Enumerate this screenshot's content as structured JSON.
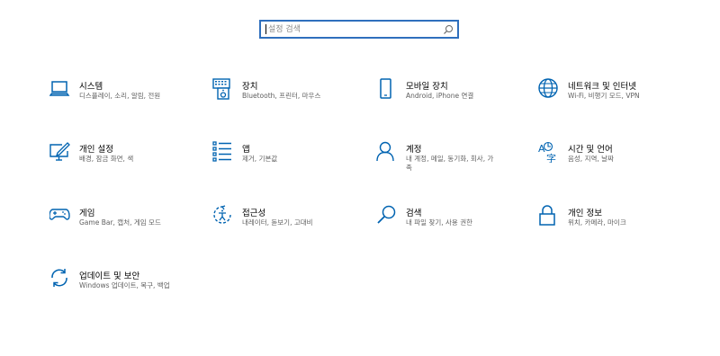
{
  "search": {
    "placeholder": "설정 검색",
    "icon": "search-icon"
  },
  "accent_color": "#0063b1",
  "tiles": [
    {
      "title": "시스템",
      "desc": "디스플레이, 소리, 알림, 전원",
      "icon": "laptop-icon"
    },
    {
      "title": "장치",
      "desc": "Bluetooth, 프린터, 마우스",
      "icon": "keyboard-speaker-icon"
    },
    {
      "title": "모바일 장치",
      "desc": "Android, iPhone 연결",
      "icon": "phone-icon"
    },
    {
      "title": "네트워크 및 인터넷",
      "desc": "Wi-Fi, 비행기 모드, VPN",
      "icon": "globe-icon"
    },
    {
      "title": "개인 설정",
      "desc": "배경, 잠금 화면, 색",
      "icon": "pen-monitor-icon"
    },
    {
      "title": "앱",
      "desc": "제거, 기본값",
      "icon": "apps-list-icon"
    },
    {
      "title": "계정",
      "desc": "내 계정, 메일, 동기화, 회사, 가\n족",
      "desc_line1": "내 계정, 메일, 동기화, 회사, 가",
      "desc_line2": "족",
      "icon": "person-icon"
    },
    {
      "title": "시간 및 언어",
      "desc": "음성, 지역, 날짜",
      "icon": "language-time-icon"
    },
    {
      "title": "게임",
      "desc": "Game Bar, 캡처, 게임 모드",
      "icon": "gamepad-icon"
    },
    {
      "title": "접근성",
      "desc": "내레이터, 돋보기, 고대비",
      "icon": "ease-of-access-icon"
    },
    {
      "title": "검색",
      "desc": "내 파일 찾기, 사용 권한",
      "icon": "search-magnifier-icon"
    },
    {
      "title": "개인 정보",
      "desc": "위치, 카메라, 마이크",
      "icon": "lock-icon"
    },
    {
      "title": "업데이트 및 보안",
      "desc": "Windows 업데이트, 복구, 백업",
      "icon": "refresh-arrows-icon"
    }
  ]
}
